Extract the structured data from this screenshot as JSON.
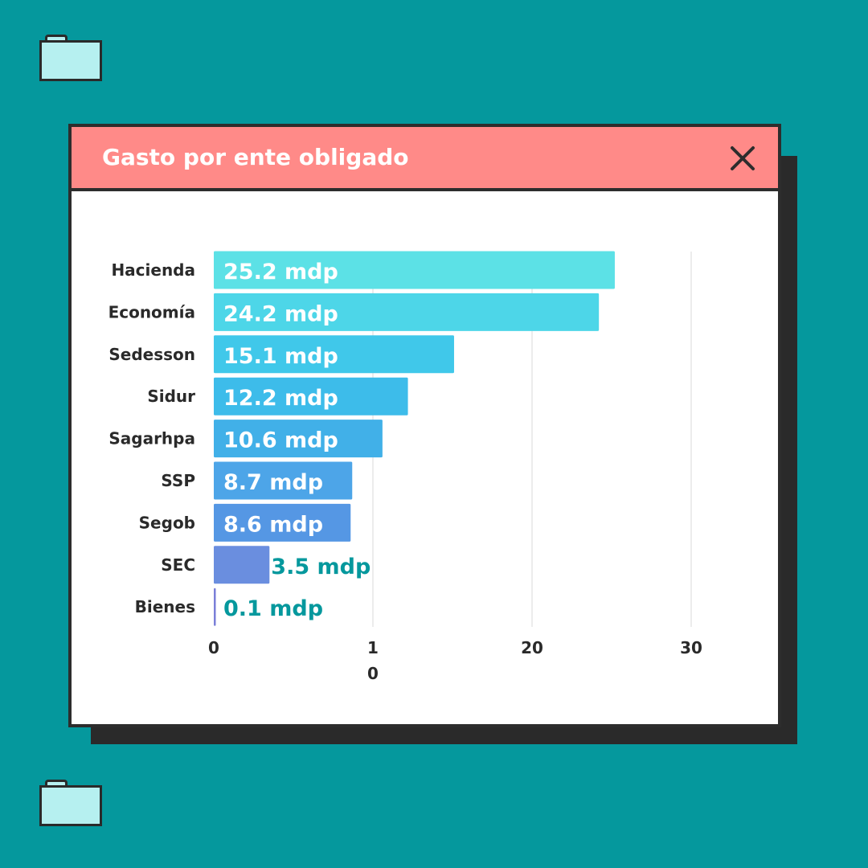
{
  "window": {
    "title": "Gasto por ente obligado"
  },
  "chart_data": {
    "type": "bar",
    "orientation": "horizontal",
    "categories": [
      "Hacienda",
      "Economía",
      "Sedesson",
      "Sidur",
      "Sagarhpa",
      "SSP",
      "Segob",
      "SEC",
      "Bienes"
    ],
    "values": [
      25.2,
      24.2,
      15.1,
      12.2,
      10.6,
      8.7,
      8.6,
      3.5,
      0.1
    ],
    "data_labels": [
      "25.2 mdp",
      "24.2 mdp",
      "15.1 mdp",
      "12.2 mdp",
      "10.6 mdp",
      "8.7 mdp",
      "8.6 mdp",
      "3.5 mdp",
      "0.1 mdp"
    ],
    "x_ticks": [
      0,
      10,
      20,
      30
    ],
    "tick_labels": [
      "0",
      "1\n0",
      "20",
      "30"
    ],
    "xlim": [
      0,
      30
    ],
    "grid": true,
    "bar_colors": [
      "#5ce1e6",
      "#4dd6e8",
      "#40c8ea",
      "#3dbcea",
      "#41b0e8",
      "#4da5e8",
      "#5597e4",
      "#6a8edf",
      "#7a7fd8"
    ],
    "label_color_inside": "#ffffff",
    "label_color_outside": "#05989d",
    "grid_color": "#e6e6e6",
    "text_color": "#2a2a2a"
  }
}
